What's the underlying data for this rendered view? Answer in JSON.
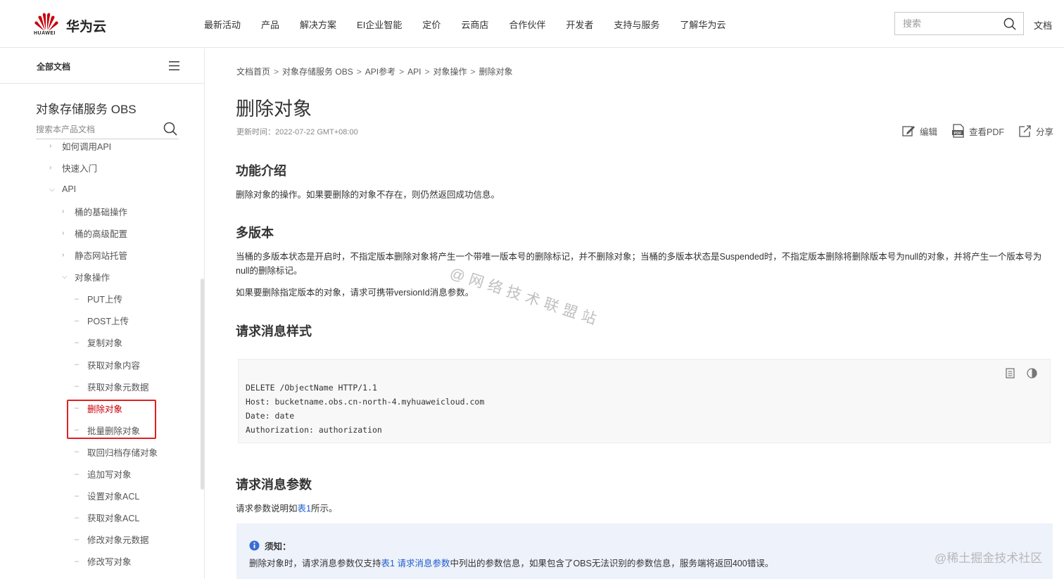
{
  "header": {
    "logo_text": "华为云",
    "logo_sub": "HUAWEI",
    "nav": [
      "最新活动",
      "产品",
      "解决方案",
      "EI企业智能",
      "定价",
      "云商店",
      "合作伙伴",
      "开发者",
      "支持与服务",
      "了解华为云"
    ],
    "search_placeholder": "搜索",
    "doc_link": "文档",
    "brand_color": "#c7000b"
  },
  "sidebar": {
    "head_title": "全部文档",
    "product_name": "对象存储服务 OBS",
    "search_placeholder": "搜索本产品文档",
    "items": [
      {
        "label": "如何调用API",
        "kind": "collapsed"
      },
      {
        "label": "快速入门",
        "kind": "collapsed"
      },
      {
        "label": "API",
        "kind": "expanded"
      },
      {
        "label": "桶的基础操作",
        "kind": "collapsed"
      },
      {
        "label": "桶的高级配置",
        "kind": "collapsed"
      },
      {
        "label": "静态网站托管",
        "kind": "collapsed"
      },
      {
        "label": "对象操作",
        "kind": "expanded"
      },
      {
        "label": "PUT上传",
        "kind": "leaf"
      },
      {
        "label": "POST上传",
        "kind": "leaf"
      },
      {
        "label": "复制对象",
        "kind": "leaf"
      },
      {
        "label": "获取对象内容",
        "kind": "leaf"
      },
      {
        "label": "获取对象元数据",
        "kind": "leaf"
      },
      {
        "label": "删除对象",
        "kind": "leaf"
      },
      {
        "label": "批量删除对象",
        "kind": "leaf"
      },
      {
        "label": "取回归档存储对象",
        "kind": "leaf"
      },
      {
        "label": "追加写对象",
        "kind": "leaf"
      },
      {
        "label": "设置对象ACL",
        "kind": "leaf"
      },
      {
        "label": "获取对象ACL",
        "kind": "leaf"
      },
      {
        "label": "修改对象元数据",
        "kind": "leaf"
      },
      {
        "label": "修改写对象",
        "kind": "leaf"
      }
    ]
  },
  "main": {
    "breadcrumb": [
      "文档首页",
      "对象存储服务 OBS",
      "API参考",
      "API",
      "对象操作",
      "删除对象"
    ],
    "title": "删除对象",
    "updated": "更新时间：2022-07-22 GMT+08:00",
    "actions": {
      "edit": "编辑",
      "pdf": "查看PDF",
      "share": "分享"
    },
    "sec_intro": {
      "heading": "功能介绍",
      "text": "删除对象的操作。如果要删除的对象不存在，则仍然返回成功信息。"
    },
    "sec_version": {
      "heading": "多版本",
      "text1": "当桶的多版本状态是开启时，不指定版本删除对象将产生一个带唯一版本号的删除标记，并不删除对象；当桶的多版本状态是Suspended时，不指定版本删除将删除版本号为null的对象，并将产生一个版本号为null的删除标记。",
      "text2": "如果要删除指定版本的对象，请求可携带versionId消息参数。"
    },
    "sec_request": {
      "heading": "请求消息样式",
      "code": "DELETE /ObjectName HTTP/1.1\nHost: bucketname.obs.cn-north-4.myhuaweicloud.com\nDate: date\nAuthorization: authorization"
    },
    "sec_params": {
      "heading": "请求消息参数",
      "text_before": "请求参数说明如",
      "text_link": "表1",
      "text_after": "所示。"
    },
    "note": {
      "title": "须知：",
      "before": "删除对象时，请求消息参数仅支持",
      "link": "表1 请求消息参数",
      "after": "中列出的参数信息，如果包含了OBS无法识别的参数信息，服务端将返回400错误。"
    }
  },
  "watermark": "@网络技术联盟站",
  "credit": "@稀土掘金技术社区"
}
